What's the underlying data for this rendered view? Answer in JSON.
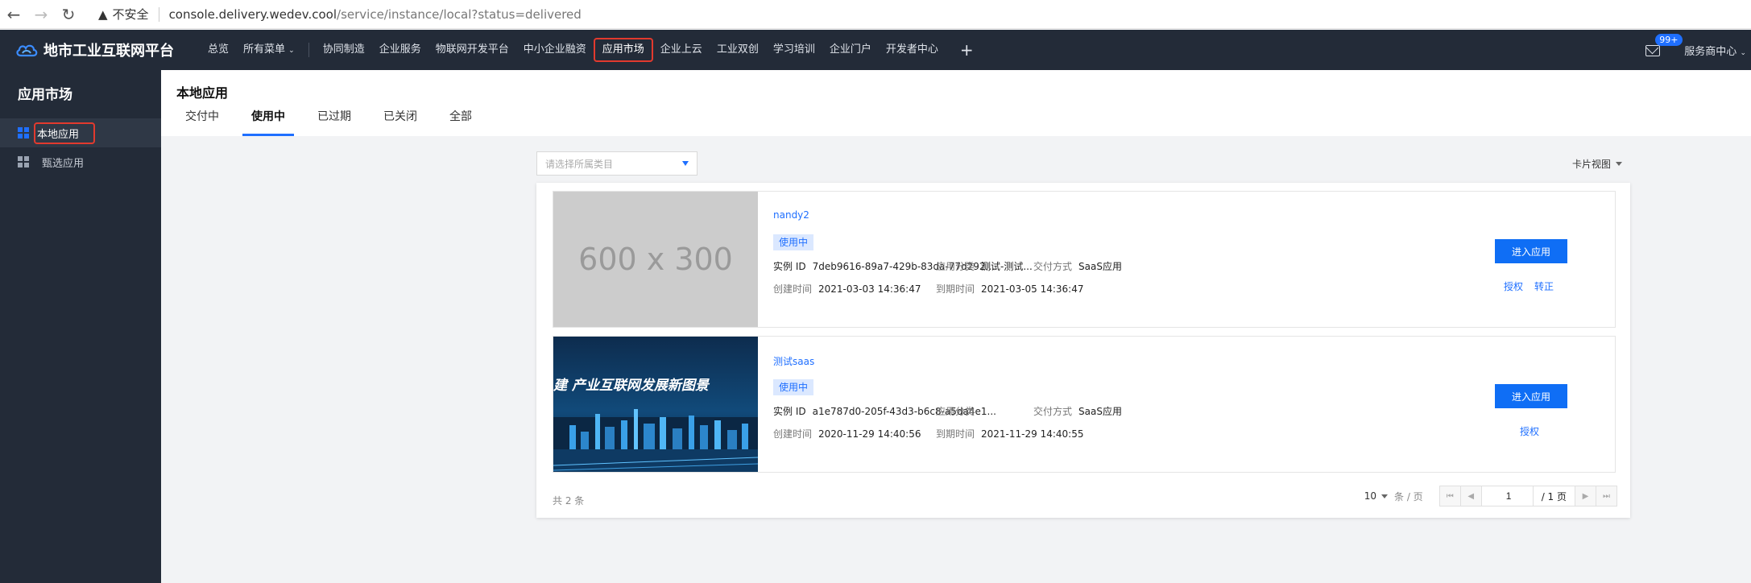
{
  "browser": {
    "security_label": "不安全",
    "url_host": "console.delivery.wedev.cool",
    "url_path": "/service/instance/local?status=delivered"
  },
  "topnav": {
    "logo_text": "地市工业互联网平台",
    "menu": [
      "总览",
      "所有菜单",
      "协同制造",
      "企业服务",
      "物联网开发平台",
      "中小企业融资",
      "应用市场",
      "企业上云",
      "工业双创",
      "学习培训",
      "企业门户",
      "开发者中心"
    ],
    "plus": "+",
    "badge": "99+",
    "account": "服务商中心"
  },
  "sidebar": {
    "title": "应用市场",
    "items": [
      "本地应用",
      "甄选应用"
    ]
  },
  "page": {
    "title": "本地应用",
    "tabs": [
      "交付中",
      "使用中",
      "已过期",
      "已关闭",
      "全部"
    ],
    "active_tab": "使用中"
  },
  "filter": {
    "category_placeholder": "请选择所属类目",
    "view_mode": "卡片视图"
  },
  "cards": [
    {
      "thumb_text": "600 x 300",
      "name": "nandy2",
      "status": "使用中",
      "instance_label": "实例 ID",
      "instance_id": "7deb9616-89a7-429b-83da-77d292...",
      "category_label": "应用分类",
      "category": "测试-测试...",
      "delivery_label": "交付方式",
      "delivery": "SaaS应用",
      "created_label": "创建时间",
      "created": "2021-03-03 14:36:47",
      "expire_label": "到期时间",
      "expire": "2021-03-05 14:36:47",
      "enter_label": "进入应用",
      "links": [
        "授权",
        "转正"
      ]
    },
    {
      "thumb_text": "建 产业互联网发展新图景",
      "name": "测试saas",
      "status": "使用中",
      "instance_label": "实例 ID",
      "instance_id": "a1e787d0-205f-43d3-b6c8-a5da4e1...",
      "category_label": "应用分类",
      "category": "",
      "delivery_label": "交付方式",
      "delivery": "SaaS应用",
      "created_label": "创建时间",
      "created": "2020-11-29 14:40:56",
      "expire_label": "到期时间",
      "expire": "2021-11-29 14:40:55",
      "enter_label": "进入应用",
      "links": [
        "授权"
      ]
    }
  ],
  "pagination": {
    "total_text": "共 2 条",
    "page_size": "10",
    "page_size_unit": "条 / 页",
    "current_page": "1",
    "total_pages": "/ 1 页"
  },
  "colors": {
    "nav_bg": "#232b38",
    "accent": "#1f6fff",
    "highlight_border": "#e23a2e"
  }
}
